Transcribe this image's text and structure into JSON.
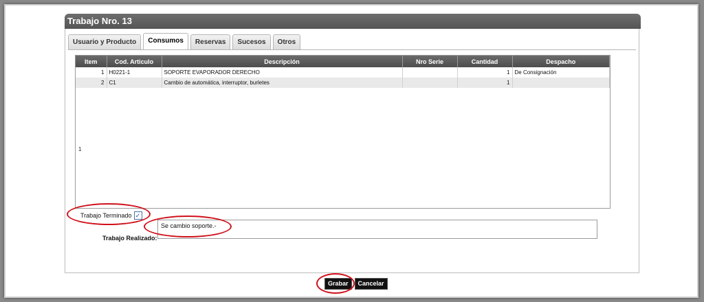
{
  "window": {
    "title": "Trabajo Nro. 13"
  },
  "tabs": [
    {
      "label": "Usuario y Producto",
      "active": false
    },
    {
      "label": "Consumos",
      "active": true
    },
    {
      "label": "Reservas",
      "active": false
    },
    {
      "label": "Sucesos",
      "active": false
    },
    {
      "label": "Otros",
      "active": false
    }
  ],
  "grid": {
    "columns": [
      "Item",
      "Cod. Articulo",
      "Descripción",
      "Nro Serie",
      "Cantidad",
      "Despacho"
    ],
    "rows": [
      {
        "item": "1",
        "cod": "H0221-1",
        "descripcion": "SOPORTE EVAPORADOR DERECHO",
        "serie": "",
        "cantidad": "1",
        "despacho": "De Consignación"
      },
      {
        "item": "2",
        "cod": "C1",
        "descripcion": "Cambio de automática, interruptor, burletes",
        "serie": "",
        "cantidad": "1",
        "despacho": ""
      }
    ],
    "page_number": "1"
  },
  "form": {
    "terminado_label": "Trabajo Terminado",
    "terminado_checked": true,
    "terminado_mark": "✓",
    "realizado_label": "Trabajo Realizado:",
    "realizado_value": "Se cambio soporte.-"
  },
  "buttons": {
    "grabar": "Grabar",
    "cancelar": "Cancelar"
  },
  "colors": {
    "annotation": "#d0101a",
    "header": "#555555"
  }
}
